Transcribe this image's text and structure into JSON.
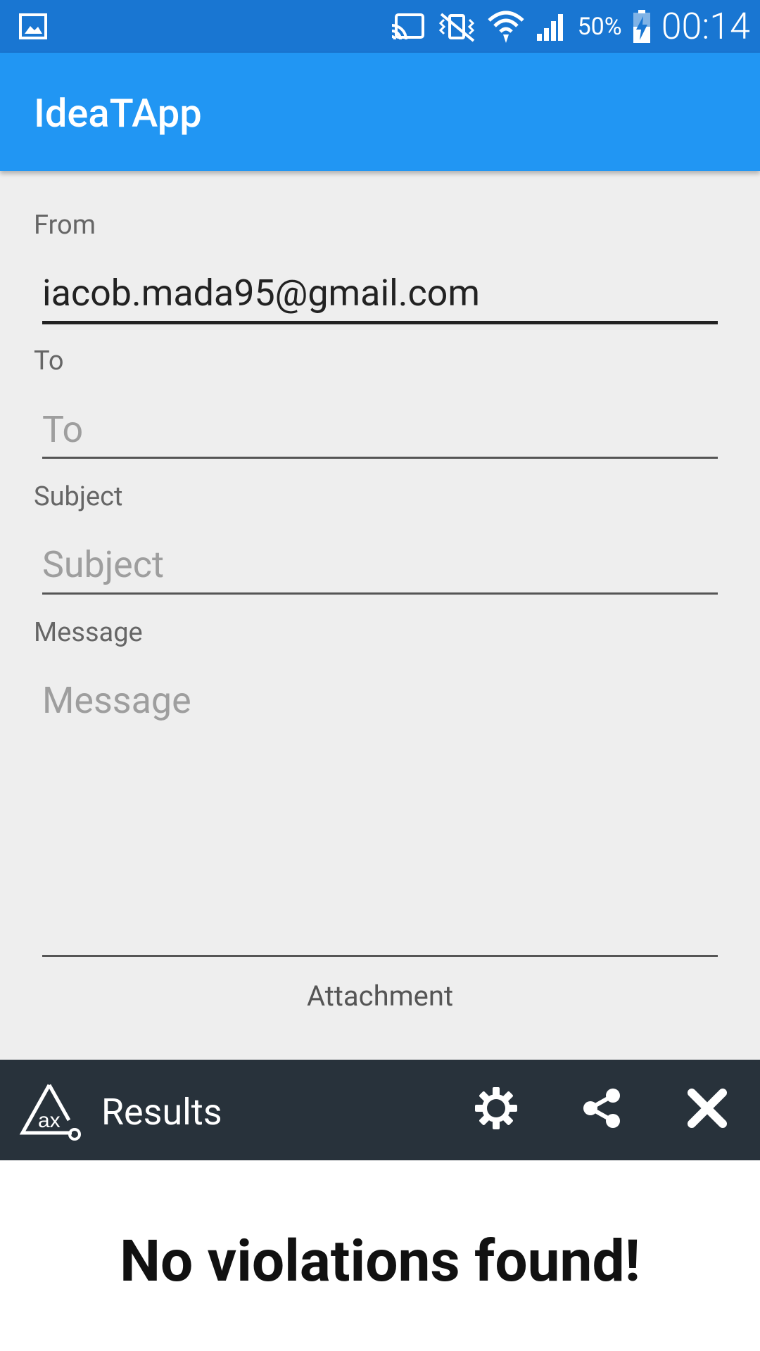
{
  "status_bar": {
    "battery_percent": "50%",
    "time": "00:14",
    "icons": [
      "gallery-icon",
      "cast-icon",
      "vibrate-icon",
      "wifi-icon",
      "signal-icon",
      "battery-charging-icon"
    ]
  },
  "app_bar": {
    "title": "IdeaTApp",
    "color": "#2196f3"
  },
  "form": {
    "from": {
      "label": "From",
      "value": "iacob.mada95@gmail.com"
    },
    "to": {
      "label": "To",
      "placeholder": "To",
      "value": ""
    },
    "subject": {
      "label": "Subject",
      "placeholder": "Subject",
      "value": ""
    },
    "message": {
      "label": "Message",
      "placeholder": "Message",
      "value": ""
    },
    "attachment_label": "Attachment"
  },
  "results_bar": {
    "title": "Results",
    "icons": [
      "ax-logo-icon",
      "settings-icon",
      "share-icon",
      "close-icon"
    ],
    "color": "#28323b"
  },
  "results_panel": {
    "message": "No violations found!"
  }
}
